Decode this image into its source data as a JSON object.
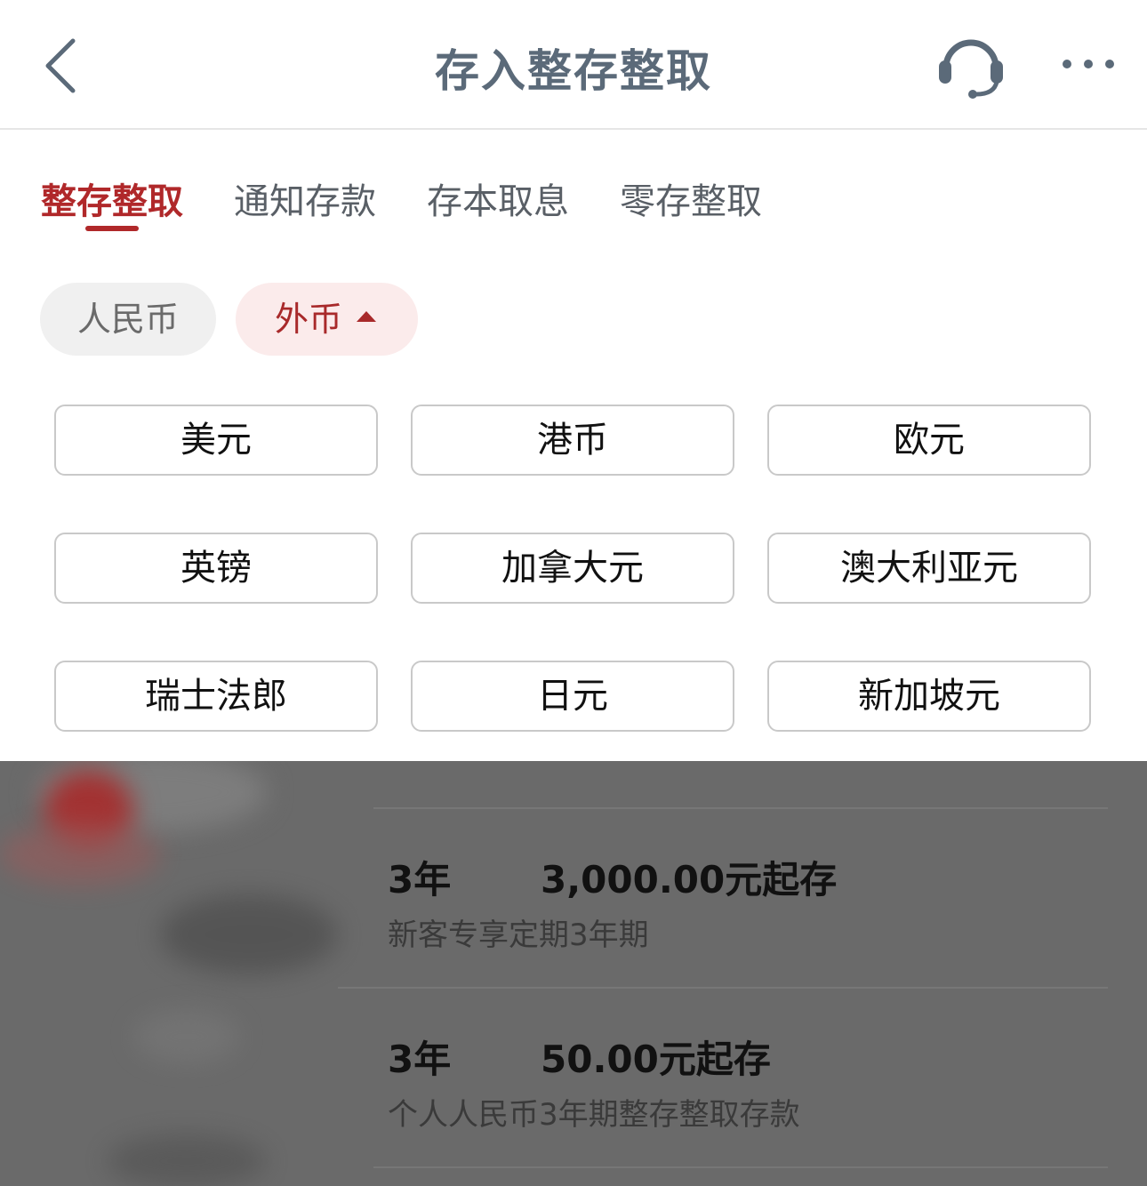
{
  "header": {
    "title": "存入整存整取",
    "back_icon": "chevron-left-icon",
    "support_icon": "headset-icon",
    "more_icon": "more-dots-icon"
  },
  "tabs": [
    {
      "label": "整存整取",
      "active": true
    },
    {
      "label": "通知存款",
      "active": false
    },
    {
      "label": "存本取息",
      "active": false
    },
    {
      "label": "零存整取",
      "active": false
    }
  ],
  "currency_type": {
    "rmb_label": "人民币",
    "foreign_label": "外币",
    "foreign_expanded": true
  },
  "foreign_currencies": [
    "美元",
    "港币",
    "欧元",
    "英镑",
    "加拿大元",
    "澳大利亚元",
    "瑞士法郎",
    "日元",
    "新加坡元"
  ],
  "products": [
    {
      "term": "3年",
      "amount": "3,000.00元起存",
      "description": "新客专享定期3年期"
    },
    {
      "term": "3年",
      "amount": "50.00元起存",
      "description": "个人人民币3年期整存整取存款"
    }
  ],
  "colors": {
    "accent": "#b0282a",
    "title": "#5b6a79",
    "overlay": "#6a6a6a"
  }
}
